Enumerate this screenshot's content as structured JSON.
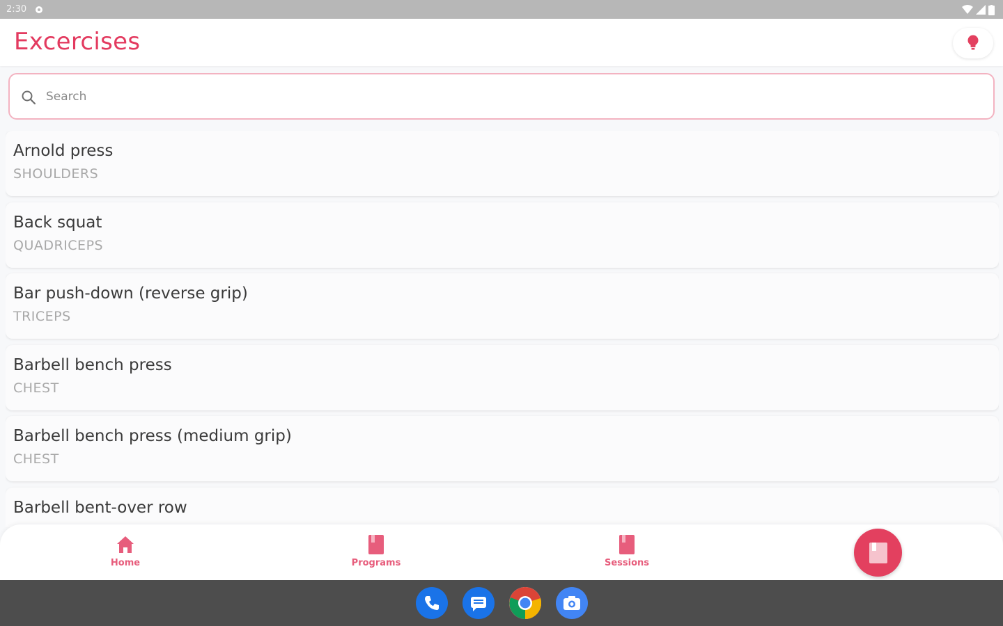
{
  "status_bar": {
    "time": "2:30"
  },
  "header": {
    "title": "Excercises"
  },
  "search": {
    "placeholder": "Search"
  },
  "exercises": [
    {
      "name": "Arnold press",
      "group": "SHOULDERS"
    },
    {
      "name": "Back squat",
      "group": "QUADRICEPS"
    },
    {
      "name": "Bar push-down (reverse grip)",
      "group": "TRICEPS"
    },
    {
      "name": "Barbell bench press",
      "group": "CHEST"
    },
    {
      "name": "Barbell bench press (medium grip)",
      "group": "CHEST"
    },
    {
      "name": "Barbell bent-over row",
      "group": ""
    }
  ],
  "bottom_nav": {
    "items": [
      {
        "label": "Home",
        "icon": "home-icon"
      },
      {
        "label": "Programs",
        "icon": "book-icon"
      },
      {
        "label": "Sessions",
        "icon": "book-icon"
      }
    ],
    "fab_icon": "book-icon"
  },
  "dock": {
    "apps": [
      "phone-icon",
      "messages-icon",
      "chrome-icon",
      "camera-icon"
    ]
  },
  "colors": {
    "accent": "#e33a5f",
    "nav_label": "#e75d7c",
    "search_border": "#f3b3c1",
    "dock_bg": "#4d4d4d"
  }
}
